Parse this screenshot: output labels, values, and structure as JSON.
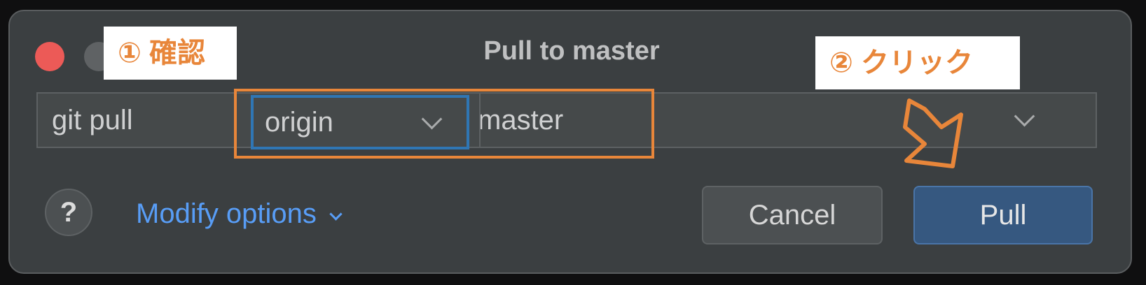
{
  "window": {
    "title": "Pull to master"
  },
  "command": {
    "prefix": "git pull",
    "remote": "origin",
    "branch": "master"
  },
  "help": {
    "label": "?"
  },
  "modify_options": {
    "label": "Modify options"
  },
  "buttons": {
    "cancel": "Cancel",
    "pull": "Pull"
  },
  "annotations": {
    "step1": "① 確認",
    "step2": "② クリック"
  },
  "colors": {
    "annotation": "#e8863a",
    "link": "#589df6",
    "primary_button": "#365880",
    "close_button": "#ec5a57",
    "focus_border": "#2f76b4"
  },
  "icons": {
    "remote_dropdown": "chevron-down-icon",
    "branch_dropdown": "chevron-down-icon",
    "modify_options": "chevron-down-icon",
    "annotation_arrow": "arrow-icon"
  }
}
